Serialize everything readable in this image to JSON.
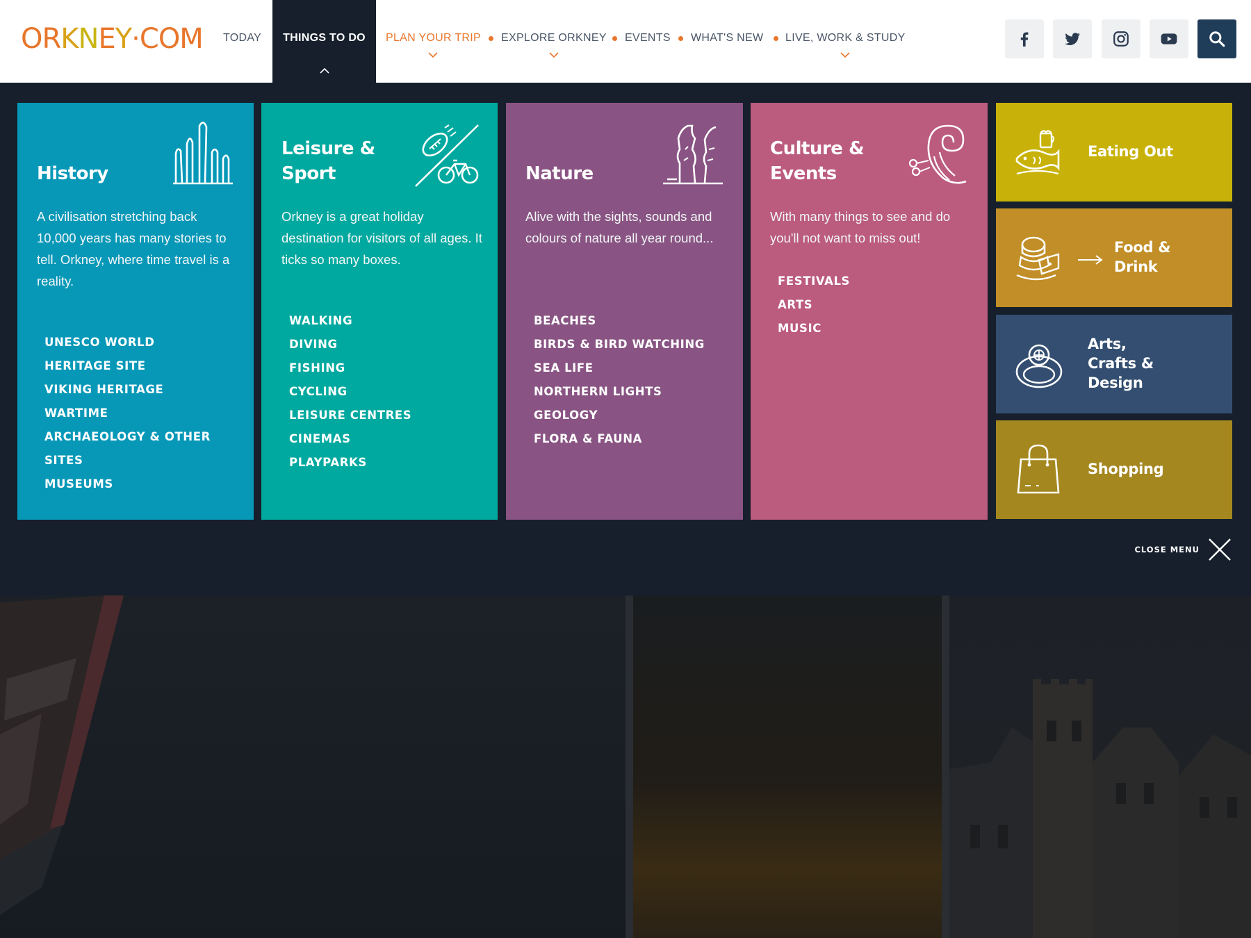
{
  "header": {
    "logo_text": "ORKNEY·COM",
    "nav": {
      "today": "TODAY",
      "things_to_do": "THINGS TO DO",
      "plan_your_trip": "PLAN YOUR TRIP",
      "explore_orkney": "EXPLORE ORKNEY",
      "events": "EVENTS",
      "whats_new": "WHAT'S NEW",
      "live_work_study": "LIVE, WORK & STUDY"
    },
    "social_icons": [
      "facebook-icon",
      "twitter-icon",
      "instagram-icon",
      "youtube-icon",
      "search-icon"
    ]
  },
  "menu": {
    "cards": [
      {
        "title_line1": "History",
        "title_line2": "",
        "color": "#0798b8",
        "icon": "standing-stones-icon",
        "description": "A civilisation stretching back 10,000 years has many stories to tell. Orkney, where time travel is a reality.",
        "links": [
          "UNESCO WORLD",
          "HERITAGE SITE",
          "VIKING HERITAGE",
          "WARTIME",
          "ARCHAEOLOGY & OTHER",
          "SITES",
          "MUSEUMS"
        ]
      },
      {
        "title_line1": "Leisure &",
        "title_line2": "Sport",
        "color": "#00a99f",
        "icon": "football-bicycle-icon",
        "description": "Orkney is a great holiday destination for visitors of all ages. It ticks so many boxes.",
        "links": [
          "WALKING",
          "DIVING",
          "FISHING",
          "CYCLING",
          "LEISURE CENTRES",
          "CINEMAS",
          "PLAYPARKS"
        ]
      },
      {
        "title_line1": "Nature",
        "title_line2": "",
        "color": "#895483",
        "icon": "sea-stack-icon",
        "description": "Alive with the sights, sounds and colours of nature all year round...",
        "links": [
          "BEACHES",
          "BIRDS & BIRD WATCHING",
          "SEA LIFE",
          "NORTHERN LIGHTS",
          "GEOLOGY",
          "FLORA & FAUNA"
        ]
      },
      {
        "title_line1": "Culture &",
        "title_line2": "Events",
        "color": "#bb5b7d",
        "icon": "spiral-wave-icon",
        "description": "With many things to see and do you'll not want to miss out!",
        "links": [
          "FESTIVALS",
          "ARTS",
          "MUSIC"
        ]
      }
    ],
    "tiles": [
      {
        "label_line1": "Eating Out",
        "label_line2": "",
        "label_line3": "",
        "color": "#c8b209",
        "icon": "fish-beer-icon"
      },
      {
        "label_line1": "Food &",
        "label_line2": "Drink",
        "label_line3": "",
        "color": "#c18e27",
        "icon": "bannock-cheese-icon"
      },
      {
        "label_line1": "Arts,",
        "label_line2": "Crafts &",
        "label_line3": "Design",
        "color": "#334e70",
        "icon": "ring-icon"
      },
      {
        "label_line1": "Shopping",
        "label_line2": "",
        "label_line3": "",
        "color": "#a4871f",
        "icon": "shopping-bag-icon"
      }
    ],
    "close_label": "CLOSE MENU"
  },
  "colors": {
    "panel_bg": "#161f2b",
    "accent_orange": "#e8762b",
    "nav_text": "#4a5667"
  }
}
